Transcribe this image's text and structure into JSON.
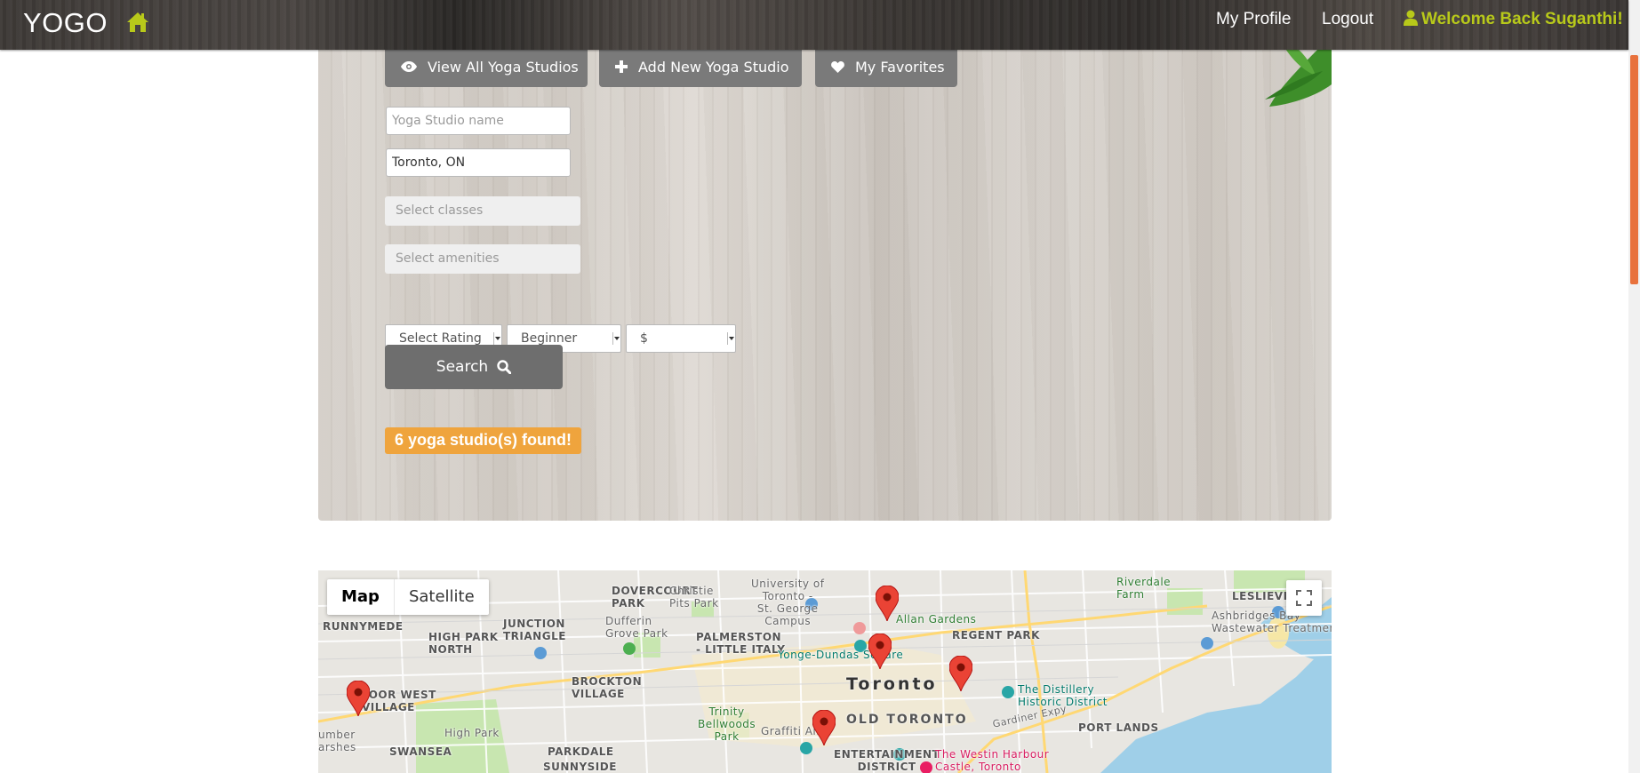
{
  "navbar": {
    "brand": "YOGO",
    "links": {
      "profile": "My Profile",
      "logout": "Logout"
    },
    "welcome": "Welcome Back Suganthi!",
    "colors": {
      "welcome": "#b8c91a",
      "home_icon": "#b8c91a"
    }
  },
  "hero": {
    "tabs": {
      "view_all": "View All Yoga Studios",
      "add_new": "Add New Yoga Studio",
      "favorites": "My Favorites"
    },
    "inputs": {
      "studio_name_placeholder": "Yoga Studio name",
      "location_value": "Toronto, ON"
    },
    "multiselect": {
      "classes_placeholder": "Select classes",
      "amenities_placeholder": "Select amenities"
    },
    "selects": {
      "rating": "Select Rating",
      "level": "Beginner",
      "price": "$"
    },
    "search_label": "Search",
    "results_badge": "6 yoga studio(s) found!",
    "colors": {
      "badge": "#efa43d",
      "button": "#7a7a7a"
    }
  },
  "map": {
    "controls": {
      "map": "Map",
      "satellite": "Satellite"
    },
    "labels": {
      "dovercourt_park": "DOVERCOURT\nPARK",
      "christie_pits": "Christie\nPits Park",
      "uoft": "University of\nToronto -\nSt. George\nCampus",
      "riverdale": "Riverdale\nFarm",
      "leslieville": "LESLIEVILLE",
      "ashbridges": "Ashbridges Bay\nWastewater Treatment...",
      "runnymede": "RUNNYMEDE",
      "high_park_north": "HIGH PARK\nNORTH",
      "junction_triangle": "JUNCTION\nTRIANGLE",
      "dufferin_grove": "Dufferin\nGrove Park",
      "palmerston": "PALMERSTON\n- LITTLE ITALY",
      "allan_gardens": "Allan Gardens",
      "regent_park": "REGENT PARK",
      "yonge_dundas": "Yonge-Dundas Square",
      "toronto": "Toronto",
      "distillery": "The Distillery\nHistoric District",
      "brockton": "BROCKTON\nVILLAGE",
      "bloor_west": "LOOR WEST\nVILLAGE",
      "high_park": "High Park",
      "trinity": "Trinity\nBellwoods\nPark",
      "old_toronto": "OLD TORONTO",
      "graffiti": "Graffiti Alle",
      "port_lands": "PORT LANDS",
      "swansea": "SWANSEA",
      "parkdale": "PARKDALE",
      "sunnyside": "SUNNYSIDE",
      "entertainment": "ENTERTAINMENT\nDISTRICT",
      "westin": "The Westin Harbour\nCastle, Toronto",
      "gardiner": "Gardiner Expy",
      "umber": "umber\narshes"
    },
    "markers": 6,
    "colors": {
      "marker": "#ea4335",
      "water": "#9fcfe8",
      "park": "#c8e6b0"
    }
  }
}
